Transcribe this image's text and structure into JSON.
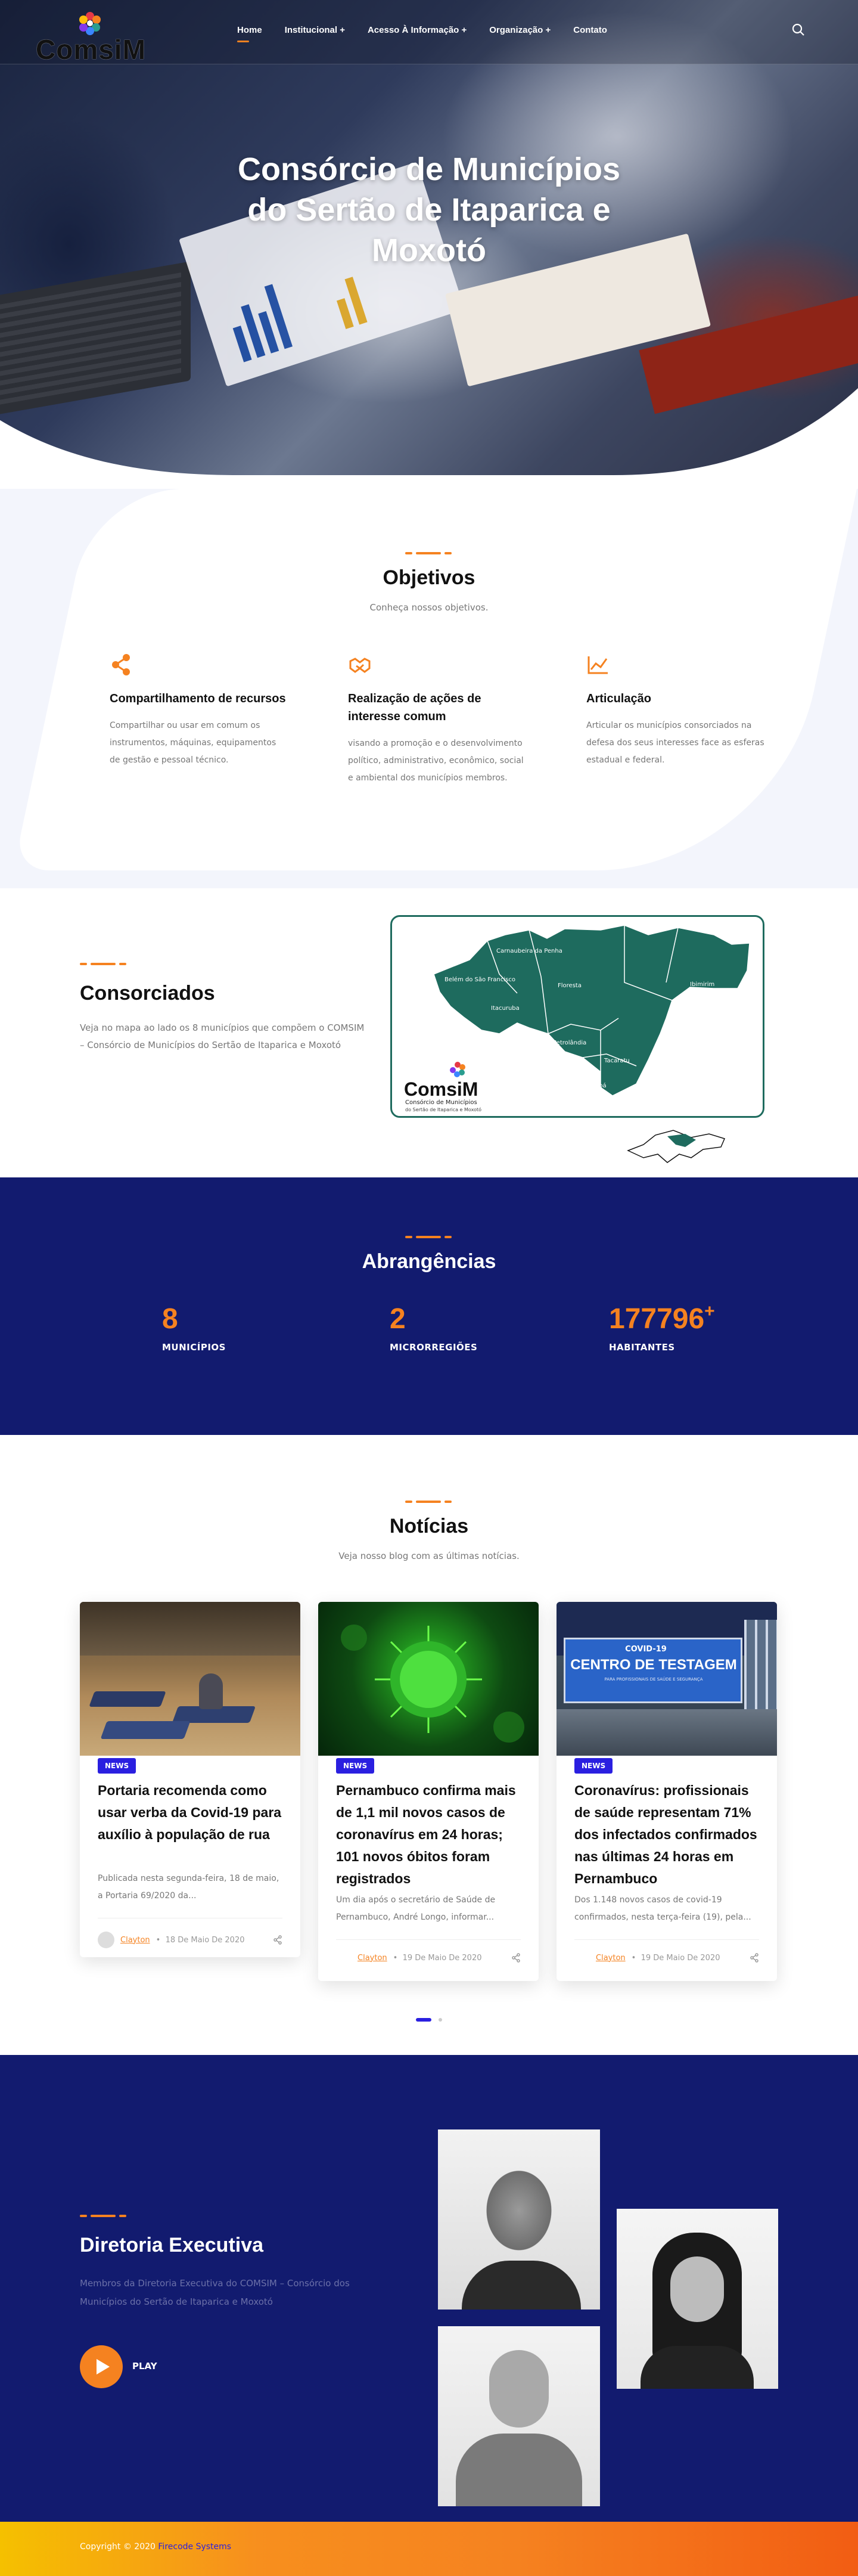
{
  "header": {
    "logo_text": "ComsiM",
    "nav": [
      {
        "label": "Home",
        "active": true
      },
      {
        "label": "Institucional +"
      },
      {
        "label": "Acesso À Informação +"
      },
      {
        "label": "Organização +"
      },
      {
        "label": "Contato"
      }
    ],
    "search_icon": "search-icon"
  },
  "hero": {
    "title_line1": "Consórcio de Municípios",
    "title_line2": "do Sertão de Itaparica e",
    "title_line3": "Moxotó"
  },
  "objetivos": {
    "title": "Objetivos",
    "subtitle": "Conheça nossos objetivos.",
    "cards": [
      {
        "icon": "share-icon",
        "title": "Compartilhamento de recursos",
        "text": "Compartilhar ou usar em comum os instrumentos, máquinas, equipamentos de gestão e pessoal técnico."
      },
      {
        "icon": "handshake-icon",
        "title": "Realização de ações de interesse comum",
        "text": "visando a promoção e o desenvolvimento político, administrativo, econômico, social e ambiental dos municípios membros."
      },
      {
        "icon": "chart-icon",
        "title": "Articulação",
        "text": "Articular os municípios consorciados na defesa dos seus interesses face as esferas estadual e federal."
      }
    ]
  },
  "consorciados": {
    "title": "Consorciados",
    "text": "Veja no mapa ao lado os 8 municípios que compõem o COMSIM – Consórcio de Municípios do Sertão de Itaparica e Moxotó",
    "map": {
      "municipios": [
        "Carnaubeira da Penha",
        "Belém do São Francisco",
        "Floresta",
        "Ibimirim",
        "Itacuruba",
        "Petrolândia",
        "Tacaratu",
        "Jatobá"
      ],
      "logo_text": "ComsiM",
      "logo_sub1": "Consórcio de Municípios",
      "logo_sub2": "do Sertão de Itaparica e Moxotó"
    }
  },
  "abrangencias": {
    "title": "Abrangências",
    "stats": [
      {
        "value": "8",
        "suffix": "",
        "label": "MUNICÍPIOS"
      },
      {
        "value": "2",
        "suffix": "",
        "label": "MICRORREGIÕES"
      },
      {
        "value": "177796",
        "suffix": "+",
        "label": "HABITANTES"
      }
    ]
  },
  "noticias": {
    "title": "Notícias",
    "subtitle": "Veja nosso blog com as últimas notícias.",
    "posts": [
      {
        "badge": "NEWS",
        "title": "Portaria recomenda como usar verba da Covid-19 para auxílio à população de rua",
        "excerpt": "Publicada nesta segunda-feira, 18 de maio, a Portaria 69/2020 da...",
        "author": "Clayton",
        "date": "18 De Maio De 2020"
      },
      {
        "badge": "NEWS",
        "title": "Pernambuco confirma mais de 1,1 mil novos casos de coronavírus em 24 horas; 101 novos óbitos foram registrados",
        "excerpt": "Um dia após o secretário de Saúde de Pernambuco, André Longo, informar...",
        "author": "Clayton",
        "date": "19 De Maio De 2020"
      },
      {
        "badge": "NEWS",
        "title": "Coronavírus: profissionais de saúde representam 71% dos infectados confirmados nas últimas 24 horas em Pernambuco",
        "excerpt": "Dos 1.148 novos casos de covid-19 confirmados, nesta terça-feira (19), pela...",
        "author": "Clayton",
        "date": "19 De Maio De 2020"
      }
    ],
    "sign_top": "COVID-19",
    "sign_main": "CENTRO DE TESTAGEM",
    "sign_sub": "PARA PROFISSIONAIS DE SAÚDE E SEGURANÇA"
  },
  "diretoria": {
    "title": "Diretoria Executiva",
    "text": "Membros da Diretoria Executiva do COMSIM – Consórcio dos Municípios do Sertão de Itaparica e Moxotó",
    "play_label": "PLAY"
  },
  "footer": {
    "copyright": "Copyright © 2020 ",
    "company": "Firecode Systems"
  },
  "colors": {
    "accent": "#f58220",
    "navy": "#121b6f",
    "badge": "#2a1fe0",
    "map_green": "#1e6b5e"
  }
}
